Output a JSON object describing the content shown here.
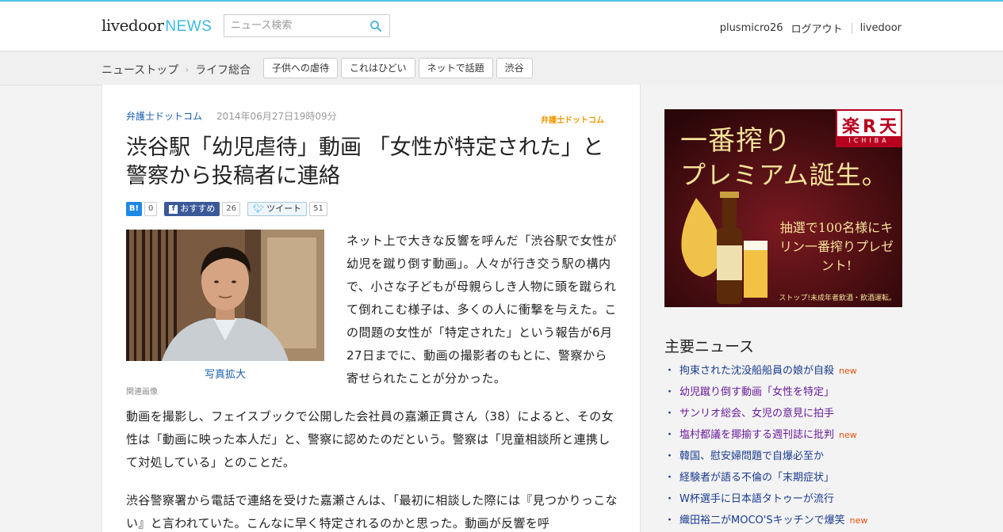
{
  "header": {
    "logo_main": "livedoor",
    "logo_news": "NEWS",
    "search_placeholder": "ニュース検索",
    "user": "plusmicro26",
    "logout": "ログアウト",
    "livedoor_link": "livedoor"
  },
  "subnav": {
    "top": "ニューストップ",
    "category": "ライフ総合",
    "tags": [
      "子供への虐待",
      "これはひどい",
      "ネットで話題",
      "渋谷"
    ]
  },
  "article": {
    "source": "弁護士ドットコム",
    "date": "2014年06月27日19時09分",
    "source_logo": "弁護士ドットコム",
    "title": "渋谷駅「幼児虐待」動画 「女性が特定された」と警察から投稿者に連絡",
    "social": {
      "hatena_label": "B!",
      "hatena_count": "0",
      "fb_label": "おすすめ",
      "fb_count": "26",
      "tw_label": "ツイート",
      "tw_count": "51"
    },
    "photo_caption": "写真拡大",
    "related_label": "関連画像",
    "lede": "ネット上で大きな反響を呼んだ「渋谷駅で女性が幼児を蹴り倒す動画」。人々が行き交う駅の構内で、小さな子どもが母親らしき人物に頭を蹴られて倒れこむ様子は、多くの人に衝撃を与えた。この問題の女性が「特定された」という報告が6月27日までに、動画の撮影者のもとに、警察から寄せられたことが分かった。",
    "p1": "動画を撮影し、フェイスブックで公開した会社員の嘉瀬正貫さん（38）によると、その女性は「動画に映った本人だ」と、警察に認めたのだという。警察は「児童相談所と連携して対処している」とのことだ。",
    "p2": "渋谷警察署から電話で連絡を受けた嘉瀬さんは、「最初に相談した際には『見つかりっこない』と言われていた。こんなに早く特定されるのかと思った。動画が反響を呼"
  },
  "ad": {
    "line1": "一番搾り",
    "line2": "プレミアム誕生。",
    "rakuten": "楽R天",
    "ichiba": "ICHIBA",
    "text": "抽選で100名様にキリン一番搾りプレゼント!",
    "footer": "ストップ!未成年者飲酒・飲酒運転。"
  },
  "sidebar": {
    "heading": "主要ニュース",
    "new_label": "new",
    "items": [
      {
        "title": "拘束された沈没船船員の娘が自殺",
        "new": true,
        "visited": false
      },
      {
        "title": "幼児蹴り倒す動画「女性を特定」",
        "new": false,
        "visited": true
      },
      {
        "title": "サンリオ総会、女児の意見に拍手",
        "new": false,
        "visited": true
      },
      {
        "title": "塩村都議を揶揄する週刊誌に批判",
        "new": true,
        "visited": true
      },
      {
        "title": "韓国、慰安婦問題で自爆必至か",
        "new": false,
        "visited": false
      },
      {
        "title": "経験者が語る不倫の「末期症状」",
        "new": false,
        "visited": false
      },
      {
        "title": "W杯選手に日本語タトゥーが流行",
        "new": false,
        "visited": false
      },
      {
        "title": "織田裕二がMOCO'Sキッチンで爆笑",
        "new": true,
        "visited": false
      }
    ]
  },
  "colors": {
    "accent": "#39b8e6",
    "link": "#1a3b8f",
    "new": "#e8500b"
  }
}
